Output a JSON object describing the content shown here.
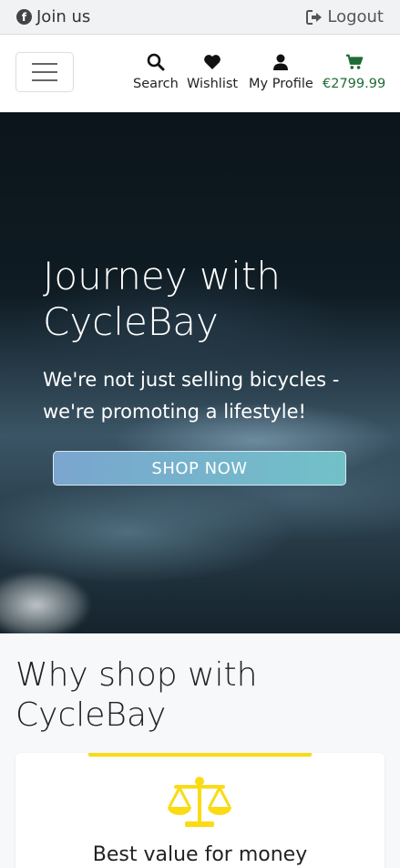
{
  "topbar": {
    "join_label": "Join us",
    "logout_label": "Logout"
  },
  "navbar": {
    "search_label": "Search",
    "wishlist_label": "Wishlist",
    "profile_label": "My Profile",
    "cart_total": "€2799.99"
  },
  "hero": {
    "title": "Journey with CycleBay",
    "subtitle": "We're not just selling bicycles - we're promoting a lifestyle!",
    "cta_label": "SHOP NOW"
  },
  "why": {
    "title": "Why shop with CycleBay",
    "cards": [
      {
        "icon": "scale-icon",
        "label": "Best value for money"
      }
    ]
  },
  "colors": {
    "accent_yellow": "#fadb14",
    "cart_green": "#1f6b36",
    "cta_gradient_start": "#7aa5cf",
    "cta_gradient_end": "#71c1c8"
  }
}
